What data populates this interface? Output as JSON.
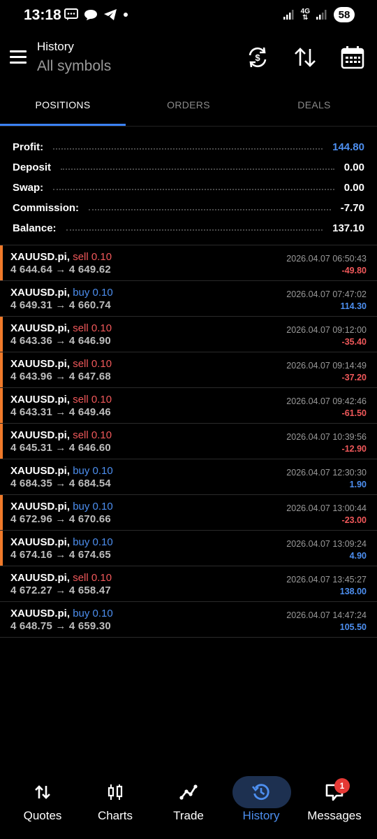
{
  "status_bar": {
    "time": "13:18",
    "network": "4G",
    "battery": "58"
  },
  "header": {
    "title": "History",
    "subtitle": "All symbols"
  },
  "tabs": [
    {
      "label": "POSITIONS",
      "active": true
    },
    {
      "label": "ORDERS",
      "active": false
    },
    {
      "label": "DEALS",
      "active": false
    }
  ],
  "summary": {
    "profit_label": "Profit:",
    "profit_value": "144.80",
    "deposit_label": "Deposit",
    "deposit_value": "0.00",
    "swap_label": "Swap:",
    "swap_value": "0.00",
    "commission_label": "Commission:",
    "commission_value": "-7.70",
    "balance_label": "Balance:",
    "balance_value": "137.10"
  },
  "deals": [
    {
      "symbol": "XAUUSD.pi,",
      "side": "sell 0.10",
      "prices": "4 644.64 → 4 649.62",
      "time": "2026.04.07 06:50:43",
      "pl": "-49.80"
    },
    {
      "symbol": "XAUUSD.pi,",
      "side": "buy 0.10",
      "prices": "4 649.31 → 4 660.74",
      "time": "2026.04.07 07:47:02",
      "pl": "114.30"
    },
    {
      "symbol": "XAUUSD.pi,",
      "side": "sell 0.10",
      "prices": "4 643.36 → 4 646.90",
      "time": "2026.04.07 09:12:00",
      "pl": "-35.40"
    },
    {
      "symbol": "XAUUSD.pi,",
      "side": "sell 0.10",
      "prices": "4 643.96 → 4 647.68",
      "time": "2026.04.07 09:14:49",
      "pl": "-37.20"
    },
    {
      "symbol": "XAUUSD.pi,",
      "side": "sell 0.10",
      "prices": "4 643.31 → 4 649.46",
      "time": "2026.04.07 09:42:46",
      "pl": "-61.50"
    },
    {
      "symbol": "XAUUSD.pi,",
      "side": "sell 0.10",
      "prices": "4 645.31 → 4 646.60",
      "time": "2026.04.07 10:39:56",
      "pl": "-12.90"
    },
    {
      "symbol": "XAUUSD.pi,",
      "side": "buy 0.10",
      "prices": "4 684.35 → 4 684.54",
      "time": "2026.04.07 12:30:30",
      "pl": "1.90"
    },
    {
      "symbol": "XAUUSD.pi,",
      "side": "buy 0.10",
      "prices": "4 672.96 → 4 670.66",
      "time": "2026.04.07 13:00:44",
      "pl": "-23.00"
    },
    {
      "symbol": "XAUUSD.pi,",
      "side": "buy 0.10",
      "prices": "4 674.16 → 4 674.65",
      "time": "2026.04.07 13:09:24",
      "pl": "4.90"
    },
    {
      "symbol": "XAUUSD.pi,",
      "side": "sell 0.10",
      "prices": "4 672.27 → 4 658.47",
      "time": "2026.04.07 13:45:27",
      "pl": "138.00"
    },
    {
      "symbol": "XAUUSD.pi,",
      "side": "buy 0.10",
      "prices": "4 648.75 → 4 659.30",
      "time": "2026.04.07 14:47:24",
      "pl": "105.50"
    }
  ],
  "bottom_nav": {
    "quotes": "Quotes",
    "charts": "Charts",
    "trade": "Trade",
    "history": "History",
    "messages": "Messages",
    "messages_badge": "1",
    "active": "history"
  },
  "colors": {
    "accent": "#4d8ff0",
    "sell": "#f0585a",
    "loss_marker": "#f07a2a"
  }
}
